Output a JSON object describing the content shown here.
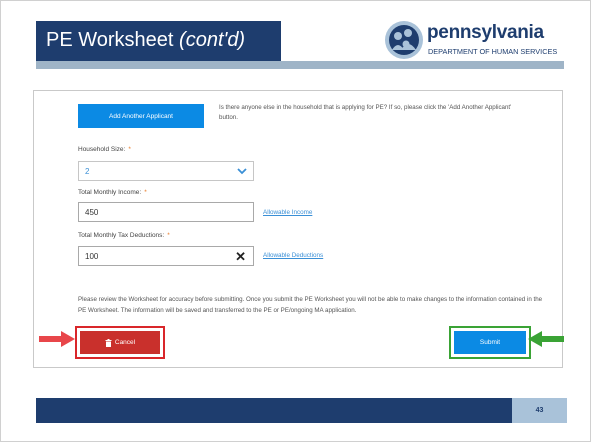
{
  "header": {
    "title_main": "PE Worksheet ",
    "title_italic": "(cont'd)"
  },
  "logo": {
    "name": "pennsylvania",
    "department": "DEPARTMENT OF HUMAN SERVICES"
  },
  "form": {
    "add_button_label": "Add Another Applicant",
    "add_note": "Is there anyone else in the household that is applying for PE? If so, please click the 'Add Another Applicant' button.",
    "household_size": {
      "label": "Household Size:",
      "required_mark": "*",
      "value": "2"
    },
    "monthly_income": {
      "label": "Total Monthly Income:",
      "required_mark": "*",
      "value": "450",
      "link": "Allowable Income"
    },
    "tax_deductions": {
      "label": "Total Monthly Tax Deductions:",
      "required_mark": "*",
      "value": "100",
      "link": "Allowable Deductions"
    },
    "review_text": "Please review the Worksheet for accuracy before submitting. Once you submit the PE Worksheet you will not be able to make changes to the information contained in the PE Worksheet. The information will be saved and transferred to the PE or PE/ongoing MA application.",
    "cancel_label": "Cancel",
    "submit_label": "Submit"
  },
  "footer": {
    "page_number": "43"
  },
  "colors": {
    "navy": "#1e3d6e",
    "primary_button": "#0b8ae4",
    "cancel_button": "#c9302c",
    "cancel_highlight": "#d9262a",
    "submit_highlight": "#3aa335",
    "required": "#e87722"
  },
  "icons": [
    "pa-logo-icon",
    "chevron-down-icon",
    "clear-icon",
    "trash-icon",
    "red-arrow-right-icon",
    "green-arrow-left-icon"
  ]
}
